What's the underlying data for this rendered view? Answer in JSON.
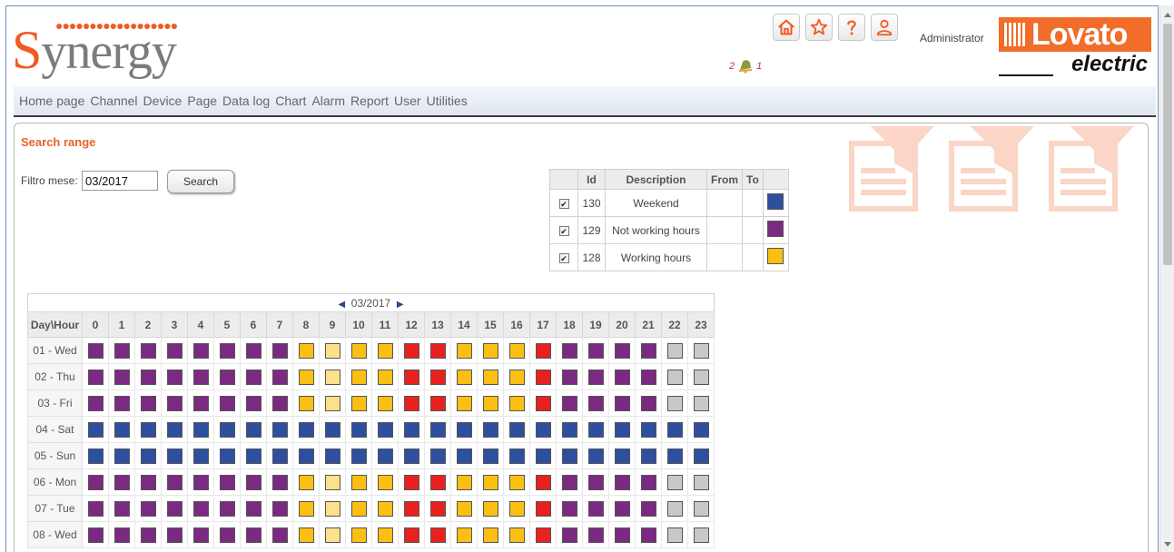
{
  "header": {
    "logo_dots": "●●●●●●●●●●●●●●●●●●",
    "logo_first": "S",
    "logo_rest": "ynergy",
    "admin_label": "Administrator",
    "alarm_left": "2",
    "alarm_right": "1",
    "lovato_top": "Lovato",
    "lovato_bottom": "electric",
    "icons": [
      "home-icon",
      "star-icon",
      "help-icon",
      "user-icon"
    ]
  },
  "menu": [
    "Home page",
    "Channel",
    "Device",
    "Page",
    "Data log",
    "Chart",
    "Alarm",
    "Report",
    "User",
    "Utilities"
  ],
  "panel": {
    "title": "Search range",
    "filter_label": "Filtro mese:",
    "filter_value": "03/2017",
    "search_button": "Search"
  },
  "legend": {
    "headers": [
      "",
      "Id",
      "Description",
      "From",
      "To",
      ""
    ],
    "rows": [
      {
        "checked": true,
        "id": "130",
        "description": "Weekend",
        "from": "",
        "to": "",
        "color": "#2e4fa0"
      },
      {
        "checked": true,
        "id": "129",
        "description": "Not working hours",
        "from": "",
        "to": "",
        "color": "#7b2a82"
      },
      {
        "checked": true,
        "id": "128",
        "description": "Working hours",
        "from": "",
        "to": "",
        "color": "#fbbf14"
      }
    ]
  },
  "calendar": {
    "month": "03/2017",
    "corner_label": "Day\\Hour",
    "hours": [
      "0",
      "1",
      "2",
      "3",
      "4",
      "5",
      "6",
      "7",
      "8",
      "9",
      "10",
      "11",
      "12",
      "13",
      "14",
      "15",
      "16",
      "17",
      "18",
      "19",
      "20",
      "21",
      "22",
      "23"
    ],
    "colors": {
      "P": "#7b2a82",
      "B": "#2e4fa0",
      "Y": "#fbbf14",
      "L": "#fde08a",
      "R": "#e8211f",
      "G": "#c8c8c8"
    },
    "days": [
      {
        "label": "01 - Wed",
        "cells": "PPPPPPPPYLYYRRYYYRPPPPGG"
      },
      {
        "label": "02 - Thu",
        "cells": "PPPPPPPPYLYYRRYYYRPPPPGG"
      },
      {
        "label": "03 - Fri",
        "cells": "PPPPPPPPYLYYRRYYYRPPPPGG"
      },
      {
        "label": "04 - Sat",
        "cells": "BBBBBBBBBBBBBBBBBBBBBBBB"
      },
      {
        "label": "05 - Sun",
        "cells": "BBBBBBBBBBBBBBBBBBBBBBBB"
      },
      {
        "label": "06 - Mon",
        "cells": "PPPPPPPPYLYYRRYYYRPPPPGG"
      },
      {
        "label": "07 - Tue",
        "cells": "PPPPPPPPYLYYRRYYYRPPPPGG"
      },
      {
        "label": "08 - Wed",
        "cells": "PPPPPPPPYLYYRRYYYRPPPPGG"
      }
    ]
  }
}
